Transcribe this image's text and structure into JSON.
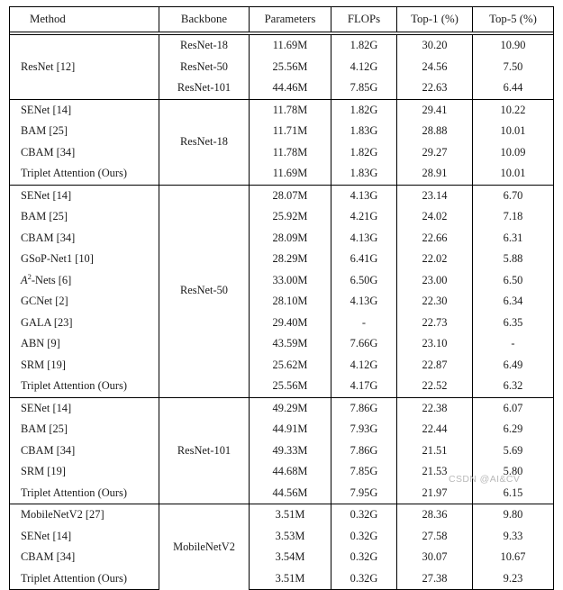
{
  "table": {
    "headers": [
      "Method",
      "Backbone",
      "Parameters",
      "FLOPs",
      "Top-1 (%)",
      "Top-5 (%)"
    ],
    "sections": [
      {
        "backbone_label": "",
        "method_group_label": "ResNet [12]",
        "rows": [
          {
            "method": "",
            "backbone": "ResNet-18",
            "params": "11.69M",
            "params_bold": true,
            "flops": "1.82G",
            "flops_bold": true,
            "top1": "30.20",
            "top1_bold": false,
            "top5": "10.90",
            "top5_bold": false
          },
          {
            "method": "ResNet [12]",
            "backbone": "ResNet-50",
            "params": "25.56M",
            "params_bold": true,
            "flops": "4.12G",
            "flops_bold": true,
            "top1": "24.56",
            "top1_bold": false,
            "top5": "7.50",
            "top5_bold": false
          },
          {
            "method": "",
            "backbone": "ResNet-101",
            "params": "44.46M",
            "params_bold": true,
            "flops": "7.85G",
            "flops_bold": true,
            "top1": "22.63",
            "top1_bold": false,
            "top5": "6.44",
            "top5_bold": false
          }
        ]
      },
      {
        "backbone_label": "ResNet-18",
        "rows": [
          {
            "method": "SENet [14]",
            "params": "11.78M",
            "params_bold": false,
            "flops": "1.82G",
            "flops_bold": false,
            "top1": "29.41",
            "top1_bold": false,
            "top5": "10.22",
            "top5_bold": false
          },
          {
            "method": "BAM [25]",
            "params": "11.71M",
            "params_bold": false,
            "flops": "1.83G",
            "flops_bold": false,
            "top1": "28.88",
            "top1_bold": true,
            "top5": "10.01",
            "top5_bold": true
          },
          {
            "method": "CBAM [34]",
            "params": "11.78M",
            "params_bold": false,
            "flops": "1.82G",
            "flops_bold": false,
            "top1": "29.27",
            "top1_bold": false,
            "top5": "10.09",
            "top5_bold": false
          },
          {
            "method": "Triplet Attention (Ours)",
            "params": "11.69M",
            "params_bold": true,
            "flops": "1.83G",
            "flops_bold": false,
            "top1": "28.91",
            "top1_bold": true,
            "top5": "10.01",
            "top5_bold": true
          }
        ]
      },
      {
        "backbone_label": "ResNet-50",
        "rows": [
          {
            "method": "SENet [14]",
            "params": "28.07M",
            "params_bold": false,
            "flops": "4.13G",
            "flops_bold": false,
            "top1": "23.14",
            "top1_bold": false,
            "top5": "6.70",
            "top5_bold": false
          },
          {
            "method": "BAM [25]",
            "params": "25.92M",
            "params_bold": false,
            "flops": "4.21G",
            "flops_bold": false,
            "top1": "24.02",
            "top1_bold": false,
            "top5": "7.18",
            "top5_bold": false
          },
          {
            "method": "CBAM [34]",
            "params": "28.09M",
            "params_bold": false,
            "flops": "4.13G",
            "flops_bold": false,
            "top1": "22.66",
            "top1_bold": false,
            "top5": "6.31",
            "top5_bold": false
          },
          {
            "method": "GSoP-Net1 [10]",
            "params": "28.29M",
            "params_bold": false,
            "flops": "6.41G",
            "flops_bold": false,
            "top1": "22.02",
            "top1_bold": true,
            "top5": "5.88",
            "top5_bold": true
          },
          {
            "method": "A2-Nets [6]",
            "method_html": true,
            "params": "33.00M",
            "params_bold": false,
            "flops": "6.50G",
            "flops_bold": false,
            "top1": "23.00",
            "top1_bold": false,
            "top5": "6.50",
            "top5_bold": false
          },
          {
            "method": "GCNet [2]",
            "params": "28.10M",
            "params_bold": false,
            "flops": "4.13G",
            "flops_bold": false,
            "top1": "22.30",
            "top1_bold": false,
            "top5": "6.34",
            "top5_bold": false
          },
          {
            "method": "GALA [23]",
            "params": "29.40M",
            "params_bold": false,
            "flops": "-",
            "flops_bold": false,
            "top1": "22.73",
            "top1_bold": false,
            "top5": "6.35",
            "top5_bold": false
          },
          {
            "method": "ABN [9]",
            "params": "43.59M",
            "params_bold": false,
            "flops": "7.66G",
            "flops_bold": false,
            "top1": "23.10",
            "top1_bold": false,
            "top5": "-",
            "top5_bold": false
          },
          {
            "method": "SRM [19]",
            "params": "25.62M",
            "params_bold": false,
            "flops": "4.12G",
            "flops_bold": false,
            "top1": "22.87",
            "top1_bold": false,
            "top5": "6.49",
            "top5_bold": false
          },
          {
            "method": "Triplet Attention (Ours)",
            "params": "25.56M",
            "params_bold": true,
            "flops": "4.17G",
            "flops_bold": false,
            "top1": "22.52",
            "top1_bold": true,
            "top5": "6.32",
            "top5_bold": true
          }
        ]
      },
      {
        "backbone_label": "ResNet-101",
        "rows": [
          {
            "method": "SENet [14]",
            "params": "49.29M",
            "params_bold": false,
            "flops": "7.86G",
            "flops_bold": false,
            "top1": "22.38",
            "top1_bold": false,
            "top5": "6.07",
            "top5_bold": false
          },
          {
            "method": "BAM [25]",
            "params": "44.91M",
            "params_bold": false,
            "flops": "7.93G",
            "flops_bold": false,
            "top1": "22.44",
            "top1_bold": false,
            "top5": "6.29",
            "top5_bold": false
          },
          {
            "method": "CBAM [34]",
            "params": "49.33M",
            "params_bold": false,
            "flops": "7.86G",
            "flops_bold": false,
            "top1": "21.51",
            "top1_bold": true,
            "top5": "5.69",
            "top5_bold": true
          },
          {
            "method": "SRM [19]",
            "params": "44.68M",
            "params_bold": false,
            "flops": "7.85G",
            "flops_bold": false,
            "top1": "21.53",
            "top1_bold": false,
            "top5": "5.80",
            "top5_bold": false
          },
          {
            "method": "Triplet Attention (Ours)",
            "params": "44.56M",
            "params_bold": true,
            "flops": "7.95G",
            "flops_bold": false,
            "top1": "21.97",
            "top1_bold": true,
            "top5": "6.15",
            "top5_bold": true
          }
        ]
      },
      {
        "backbone_label": "MobileNetV2",
        "rows": [
          {
            "method": "MobileNetV2 [27]",
            "params": "3.51M",
            "params_bold": true,
            "flops": "0.32G",
            "flops_bold": true,
            "top1": "28.36",
            "top1_bold": false,
            "top5": "9.80",
            "top5_bold": false
          },
          {
            "method": "SENet [14]",
            "params": "3.53M",
            "params_bold": false,
            "flops": "0.32G",
            "flops_bold": false,
            "top1": "27.58",
            "top1_bold": false,
            "top5": "9.33",
            "top5_bold": false
          },
          {
            "method": "CBAM [34]",
            "params": "3.54M",
            "params_bold": false,
            "flops": "0.32G",
            "flops_bold": false,
            "top1": "30.07",
            "top1_bold": false,
            "top5": "10.67",
            "top5_bold": false
          },
          {
            "method": "Triplet Attention (Ours)",
            "params": "3.51M",
            "params_bold": true,
            "flops": "0.32G",
            "flops_bold": false,
            "top1": "27.38",
            "top1_bold": true,
            "top5": "9.23",
            "top5_bold": true
          }
        ]
      }
    ]
  },
  "watermark": {
    "text": "CSDN @AI&CV"
  },
  "colors": {
    "border": "#000000",
    "text": "#1a1a1a",
    "watermark": "#b9b9b9",
    "background": "#ffffff"
  }
}
